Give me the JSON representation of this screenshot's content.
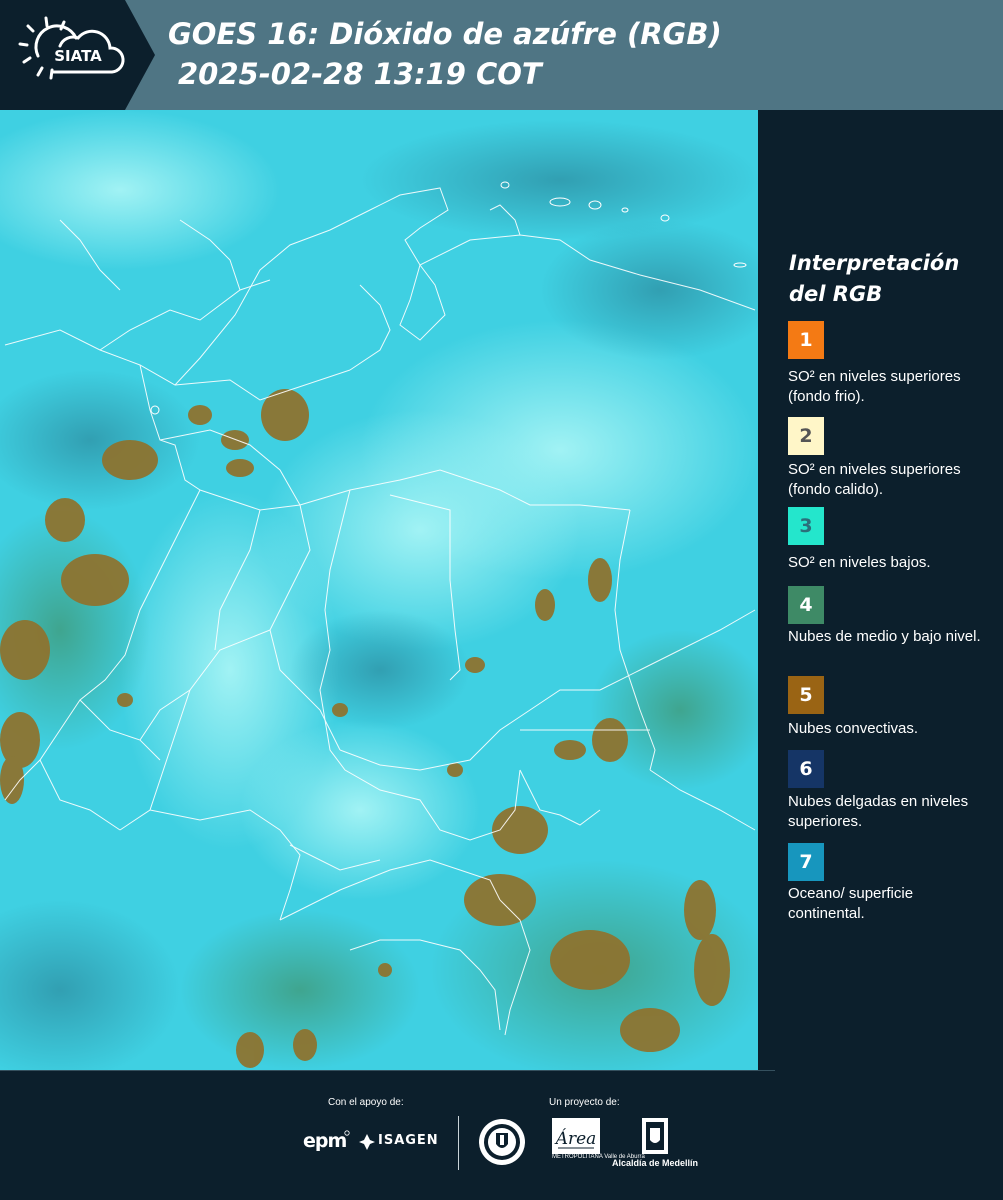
{
  "header": {
    "logo_text": "SIATA",
    "title_line1": "GOES 16: Dióxido de azúfre (RGB)",
    "title_line2": "2025-02-28 13:19 COT",
    "background_color": "#4f7584"
  },
  "legend": {
    "title_line1": "Interpretación",
    "title_line2": "del RGB",
    "items": [
      {
        "number": "1",
        "label": "SO² en niveles superiores (fondo frio).",
        "color": "#f47a14",
        "num_color": "#ffffff"
      },
      {
        "number": "2",
        "label": "SO² en niveles superiores (fondo calido).",
        "color": "#fff6c8",
        "num_color": "#555555"
      },
      {
        "number": "3",
        "label": "SO² en niveles bajos.",
        "color": "#24e6cc",
        "num_color": "#2b6f7a"
      },
      {
        "number": "4",
        "label": "Nubes de medio y bajo nivel.",
        "color": "#3e8a66",
        "num_color": "#ffffff"
      },
      {
        "number": "5",
        "label": "Nubes convectivas.",
        "color": "#9a6414",
        "num_color": "#ffffff"
      },
      {
        "number": "6",
        "label": "Nubes delgadas en niveles superiores.",
        "color": "#153566",
        "num_color": "#ffffff"
      },
      {
        "number": "7",
        "label": "Oceano/ superficie continental.",
        "color": "#1796be",
        "num_color": "#ffffff"
      }
    ]
  },
  "footer": {
    "support_label": "Con el apoyo de:",
    "project_label": "Un proyecto de:",
    "sponsor1": "epm",
    "sponsor2": "ISAGEN",
    "partner_metro": "METROPOLITANA Valle de Aburrá",
    "partner_alcaldia": "Alcaldía de Medellín"
  }
}
